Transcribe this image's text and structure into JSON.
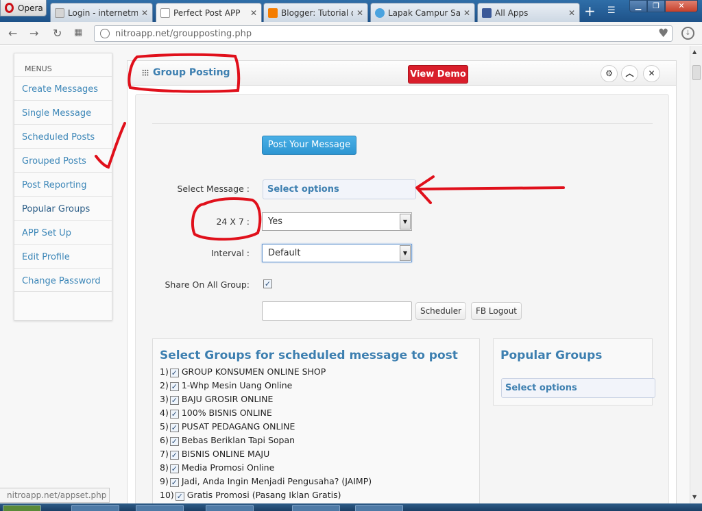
{
  "browser": {
    "menu_label": "Opera",
    "tabs": [
      {
        "title": "Login - internetmar",
        "favicon_color": "#cccccc"
      },
      {
        "title": "Perfect Post APP",
        "favicon_color": "#cccccc"
      },
      {
        "title": "Blogger: Tutorial da",
        "favicon_color": "#f57d00"
      },
      {
        "title": "Lapak Campur Sari",
        "favicon_color": "#4aa3df"
      },
      {
        "title": "All Apps",
        "favicon_color": "#3b5998"
      }
    ],
    "active_tab": 1,
    "url": "nitroapp.net/groupposting.php"
  },
  "sidebar": {
    "heading": "MENUS",
    "items": [
      {
        "label": "Create Messages"
      },
      {
        "label": "Single Message"
      },
      {
        "label": "Scheduled Posts"
      },
      {
        "label": "Grouped Posts"
      },
      {
        "label": "Post Reporting"
      },
      {
        "label": "Popular Groups"
      },
      {
        "label": "APP Set Up"
      },
      {
        "label": "Edit Profile"
      },
      {
        "label": "Change Password"
      }
    ]
  },
  "panel": {
    "title": "Group Posting",
    "view_demo_label": "View Demo"
  },
  "form": {
    "post_button_label": "Post Your Message",
    "select_message_label": "Select Message :",
    "select_message_value": "Select options",
    "schedule_label": "24 X 7 :",
    "schedule_value": "Yes",
    "interval_label": "Interval :",
    "interval_value": "Default",
    "share_all_label": "Share On All Group:",
    "share_all_checked": true,
    "scheduler_label": "Scheduler",
    "logout_label": "FB Logout"
  },
  "groups": {
    "title": "Select Groups for scheduled message to post",
    "items": [
      {
        "num": "1)",
        "name": "GROUP KONSUMEN ONLINE SHOP",
        "checked": true
      },
      {
        "num": "2)",
        "name": "1-Whp Mesin Uang Online",
        "checked": true
      },
      {
        "num": "3)",
        "name": "BAJU GROSIR ONLINE",
        "checked": true
      },
      {
        "num": "4)",
        "name": "100% BISNIS ONLINE",
        "checked": true
      },
      {
        "num": "5)",
        "name": "PUSAT PEDAGANG ONLINE",
        "checked": true
      },
      {
        "num": "6)",
        "name": "Bebas Beriklan Tapi Sopan",
        "checked": true
      },
      {
        "num": "7)",
        "name": "BISNIS ONLINE MAJU",
        "checked": true
      },
      {
        "num": "8)",
        "name": "Media Promosi Online",
        "checked": true
      },
      {
        "num": "9)",
        "name": "Jadi, Anda Ingin Menjadi Pengusaha? (JAIMP)",
        "checked": true
      },
      {
        "num": "10)",
        "name": "Gratis Promosi (Pasang Iklan Gratis)",
        "checked": true
      }
    ]
  },
  "popular": {
    "title": "Popular Groups",
    "select_value": "Select options"
  },
  "status_url": "nitroapp.net/appset.php",
  "colors": {
    "accent": "#3d7fb0",
    "demo_button": "#d91e2b",
    "post_button": "#2d96d2",
    "annotation_red": "#e0101b"
  }
}
